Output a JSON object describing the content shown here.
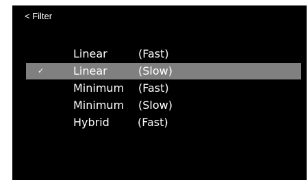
{
  "header": {
    "back_label": "< Filter"
  },
  "menu": {
    "selected_mark": "✓",
    "items": [
      {
        "name": "Linear",
        "speed": "(Fast)",
        "selected": false
      },
      {
        "name": "Linear",
        "speed": "(Slow)",
        "selected": true
      },
      {
        "name": "Minimum",
        "speed": "(Fast)",
        "selected": false
      },
      {
        "name": "Minimum",
        "speed": "(Slow)",
        "selected": false
      },
      {
        "name": "Hybrid",
        "speed": "(Fast)",
        "selected": false
      }
    ]
  },
  "colors": {
    "screen_background": "#000000",
    "text": "#ffffff",
    "selection_highlight": "#808080"
  }
}
